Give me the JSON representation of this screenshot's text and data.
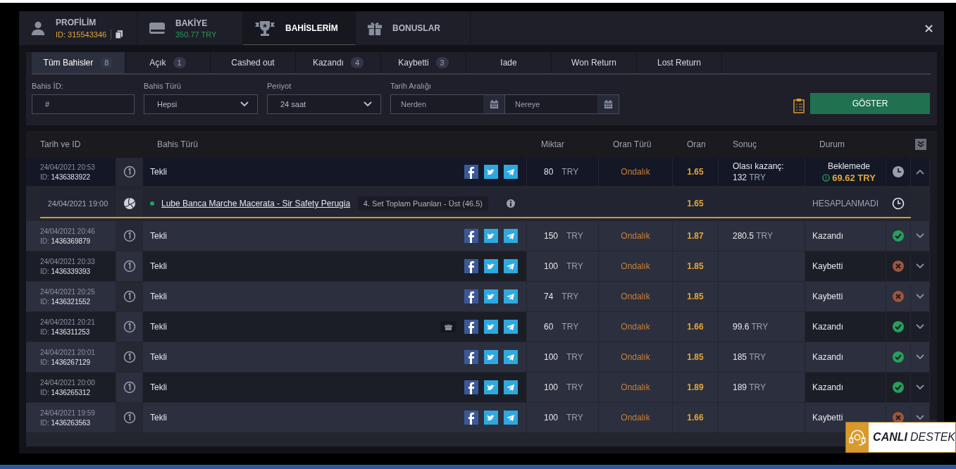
{
  "header": {
    "tabs": [
      {
        "kind": "profile",
        "title": "PROFİLİM",
        "subtitle": "ID: 315543346",
        "selected": false
      },
      {
        "kind": "balance",
        "title": "BAKİYE",
        "subtitle": "350.77 TRY",
        "selected": false
      },
      {
        "kind": "bets",
        "title": "BAHİSLERİM",
        "selected": true
      },
      {
        "kind": "bonus",
        "title": "BONUSLAR",
        "selected": false
      }
    ]
  },
  "filter_tabs": [
    {
      "label": "Tüm Bahisler",
      "count": "8",
      "selected": true
    },
    {
      "label": "Açık",
      "count": "1",
      "selected": false
    },
    {
      "label": "Cashed out",
      "selected": false
    },
    {
      "label": "Kazandı",
      "count": "4",
      "selected": false
    },
    {
      "label": "Kaybetti",
      "count": "3",
      "selected": false
    },
    {
      "label": "Iade",
      "selected": false
    },
    {
      "label": "Won Return",
      "selected": false
    },
    {
      "label": "Lost Return",
      "selected": false
    }
  ],
  "filters": {
    "bet_id": {
      "label": "Bahis İD:",
      "placeholder": "#"
    },
    "bet_type": {
      "label": "Bahis Türü",
      "value": "Hepsi"
    },
    "period": {
      "label": "Periyot",
      "value": "24 saat"
    },
    "date_range": {
      "label": "Tarih Aralığı",
      "from_placeholder": "Nerden",
      "to_placeholder": "Nereye"
    },
    "submit": "GÖSTER"
  },
  "table": {
    "columns": [
      "Tarih ve ID",
      "Bahis Türü",
      "Miktar",
      "Oran Türü",
      "Oran",
      "Sonuç",
      "Durum"
    ],
    "rows": [
      {
        "date": "24/04/2021 20:53",
        "id_label": "ID:",
        "id": "1436383922",
        "type": "Tekli",
        "gift": false,
        "amount": "80",
        "currency": "TRY",
        "odds_type": "Ondalık",
        "odds": "1.65",
        "result_label": "Olası kazanç:",
        "result": "132",
        "result_currency": "TRY",
        "status": "Beklemede",
        "kind": "pending",
        "cashout": "69.62 TRY",
        "expanded": true,
        "selections": [
          {
            "date": "24/04/2021 19:00",
            "event": "Lube Banca Marche Macerata - Sir Safety Perugia",
            "market": "4. Set Toplam Puanları - Üst (46.5)",
            "odds": "1.65",
            "status": "HESAPLANMADI"
          }
        ]
      },
      {
        "date": "24/04/2021 20:46",
        "id_label": "ID:",
        "id": "1436369879",
        "type": "Tekli",
        "gift": false,
        "amount": "150",
        "currency": "TRY",
        "odds_type": "Ondalık",
        "odds": "1.87",
        "result": "280.5",
        "result_currency": "TRY",
        "status": "Kazandı",
        "kind": "won",
        "expanded": false
      },
      {
        "date": "24/04/2021 20:33",
        "id_label": "ID:",
        "id": "1436339393",
        "type": "Tekli",
        "gift": false,
        "amount": "100",
        "currency": "TRY",
        "odds_type": "Ondalık",
        "odds": "1.85",
        "status": "Kaybetti",
        "kind": "lost",
        "expanded": false
      },
      {
        "date": "24/04/2021 20:25",
        "id_label": "ID:",
        "id": "1436321552",
        "type": "Tekli",
        "gift": false,
        "amount": "74",
        "currency": "TRY",
        "odds_type": "Ondalık",
        "odds": "1.85",
        "status": "Kaybetti",
        "kind": "lost",
        "expanded": false
      },
      {
        "date": "24/04/2021 20:21",
        "id_label": "ID:",
        "id": "1436311253",
        "type": "Tekli",
        "gift": true,
        "amount": "60",
        "currency": "TRY",
        "odds_type": "Ondalık",
        "odds": "1.66",
        "result": "99.6",
        "result_currency": "TRY",
        "status": "Kazandı",
        "kind": "won",
        "expanded": false
      },
      {
        "date": "24/04/2021 20:01",
        "id_label": "ID:",
        "id": "1436267129",
        "type": "Tekli",
        "gift": false,
        "amount": "100",
        "currency": "TRY",
        "odds_type": "Ondalık",
        "odds": "1.85",
        "result": "185",
        "result_currency": "TRY",
        "status": "Kazandı",
        "kind": "won",
        "expanded": false
      },
      {
        "date": "24/04/2021 20:00",
        "id_label": "ID:",
        "id": "1436265312",
        "type": "Tekli",
        "gift": false,
        "amount": "100",
        "currency": "TRY",
        "odds_type": "Ondalık",
        "odds": "1.89",
        "result": "189",
        "result_currency": "TRY",
        "status": "Kazandı",
        "kind": "won",
        "expanded": false
      },
      {
        "date": "24/04/2021 19:59",
        "id_label": "ID:",
        "id": "1436263563",
        "type": "Tekli",
        "gift": false,
        "amount": "100",
        "currency": "TRY",
        "odds_type": "Ondalık",
        "odds": "1.66",
        "status": "Kaybetti",
        "kind": "lost",
        "expanded": false
      }
    ]
  },
  "live_support": {
    "strong": "CANLI",
    "rest": "DESTEK"
  }
}
